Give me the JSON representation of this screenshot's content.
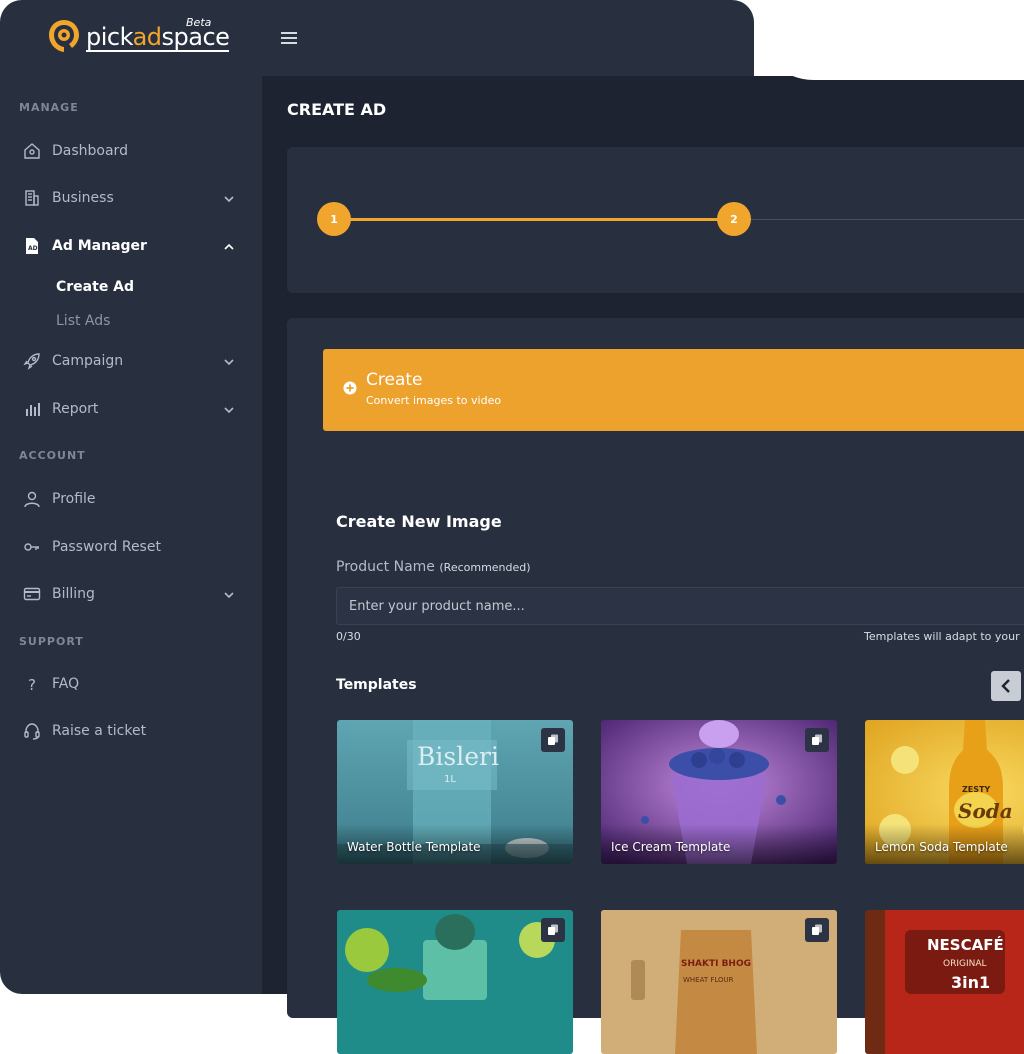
{
  "app": {
    "logo_text_pre": "pick",
    "logo_text_accent": "ad",
    "logo_text_post": "space",
    "beta_label": "Beta"
  },
  "colors": {
    "accent": "#f0a52c",
    "sidebar_bg": "#283040",
    "main_bg": "#1d2330",
    "card_bg": "#283040",
    "text_primary": "#ffffff",
    "text_muted": "#b4bac6"
  },
  "sidebar": {
    "sections": {
      "manage": "MANAGE",
      "account": "ACCOUNT",
      "support": "SUPPORT"
    },
    "items": {
      "dashboard": {
        "label": "Dashboard",
        "icon": "home-icon"
      },
      "business": {
        "label": "Business",
        "icon": "building-icon"
      },
      "ad_manager": {
        "label": "Ad Manager",
        "icon": "ad-file-icon"
      },
      "create_ad": {
        "label": "Create Ad"
      },
      "list_ads": {
        "label": "List Ads"
      },
      "campaign": {
        "label": "Campaign",
        "icon": "rocket-icon"
      },
      "report": {
        "label": "Report",
        "icon": "bar-chart-icon"
      },
      "profile": {
        "label": "Profile",
        "icon": "user-icon"
      },
      "password_reset": {
        "label": "Password Reset",
        "icon": "key-icon"
      },
      "billing": {
        "label": "Billing",
        "icon": "credit-card-icon"
      },
      "faq": {
        "label": "FAQ",
        "icon": "question-icon"
      },
      "raise_ticket": {
        "label": "Raise a ticket",
        "icon": "headset-icon"
      }
    }
  },
  "header": {
    "menu_icon": "hamburger-icon",
    "page_title": "CREATE AD"
  },
  "stepper": {
    "steps": [
      "1",
      "2"
    ],
    "current_step": 2
  },
  "banner": {
    "title": "Create",
    "subtitle": "Convert images to video",
    "icon": "plus-circle-icon"
  },
  "form": {
    "section_title": "Create New Image",
    "product_label": "Product Name",
    "product_label_note": "(Recommended)",
    "product_placeholder": "Enter your product name...",
    "product_value": "",
    "char_count": "0/30",
    "adapt_hint": "Templates will adapt to your p"
  },
  "templates": {
    "title": "Templates",
    "prev_icon": "chevron-left-icon",
    "items": [
      {
        "name": "Water Bottle Template",
        "art_text": "Bisleri",
        "art_sub": "1L"
      },
      {
        "name": "Ice Cream Template"
      },
      {
        "name": "Lemon Soda Template",
        "art_text": "Soda",
        "art_sub": "ZESTY"
      },
      {
        "name": ""
      },
      {
        "name": "",
        "art_text": "SHAKTI BHOG",
        "art_sub": "WHEAT FLOUR"
      },
      {
        "name": "",
        "art_text": "NESCAFÉ",
        "art_sub": "ORIGINAL",
        "art_badge": "3in1"
      }
    ]
  }
}
